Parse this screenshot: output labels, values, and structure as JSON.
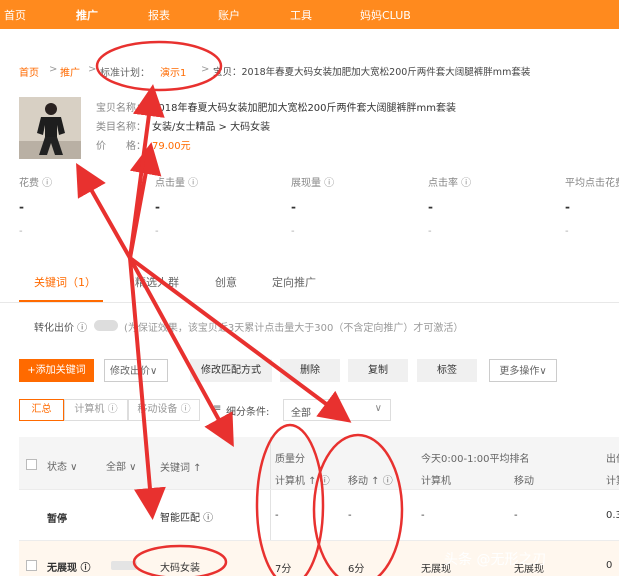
{
  "nav": [
    "首页",
    "推广",
    "报表",
    "账户",
    "工具",
    "妈妈CLUB"
  ],
  "breadcrumb": {
    "home": "首页",
    "sep": ">",
    "promo": "推广",
    "plan_label": "标准计划：",
    "plan_name": "演示1",
    "item": "宝贝：2018年春夏大码女装加肥加大宽松200斤两件套大阔腿裤胖mm套装"
  },
  "product": {
    "name_label": "宝贝名称：",
    "name": "2018年春夏大码女装加肥加大宽松200斤两件套大阔腿裤胖mm套装",
    "category_label": "类目名称：",
    "category": "女装/女士精品 > 大码女装",
    "price_label": "价　　格：",
    "price": "79.00元"
  },
  "stats": [
    {
      "label": "花费 ⓘ",
      "value": "-",
      "sub": "-"
    },
    {
      "label": "点击量 ⓘ",
      "value": "-",
      "sub": "-"
    },
    {
      "label": "展现量 ⓘ",
      "value": "-",
      "sub": "-"
    },
    {
      "label": "点击率 ⓘ",
      "value": "-",
      "sub": "-"
    },
    {
      "label": "平均点击花费",
      "value": "-",
      "sub": "-"
    }
  ],
  "tabs": [
    "关键词（1）",
    "精选人群",
    "创意",
    "定向推广"
  ],
  "bid": {
    "label": "转化出价 ⓘ",
    "note": "(为保证效果，该宝贝近3天累计点击量大于300（不含定向推广）才可激活）"
  },
  "toolbar": {
    "add": "+添加关键词",
    "modify_bid": "修改出价∨",
    "modify_match": "修改匹配方式",
    "delete": "删除",
    "copy": "复制",
    "tag": "标签",
    "more": "更多操作∨"
  },
  "filters": {
    "summary": "汇总",
    "pc": "计算机 ⓘ",
    "mobile": "移动设备 ⓘ",
    "sub_label": "细分条件:",
    "sub_value": "全部"
  },
  "table": {
    "headers": {
      "status": "状态 ∨",
      "all": "全部 ∨",
      "keyword": "关键词 ↑",
      "quality": "质量分",
      "pc": "计算机 ↑ ⓘ",
      "mobile": "移动 ↑ ⓘ",
      "rank_title": "今天0:00-1:00平均排名",
      "rank_pc": "计算机",
      "rank_mobile": "移动",
      "bid_col": "出价",
      "bid_pc": "计算"
    },
    "rows": [
      {
        "status": "暂停",
        "keyword": "智能匹配 ⓘ",
        "q_pc": "-",
        "q_mobile": "-",
        "r_pc": "-",
        "r_mobile": "-",
        "bid": "0.3"
      },
      {
        "status": "无展现 ⓘ",
        "keyword": "大码女装",
        "q_pc": "7分",
        "q_mobile": "6分",
        "r_pc": "无展现",
        "r_mobile": "无展现",
        "bid": "0"
      }
    ]
  },
  "watermark": "头条 @无形之刃",
  "colors": {
    "brand": "#ff8a1e",
    "accent": "#ff6a00",
    "annotation": "#e8312f"
  }
}
